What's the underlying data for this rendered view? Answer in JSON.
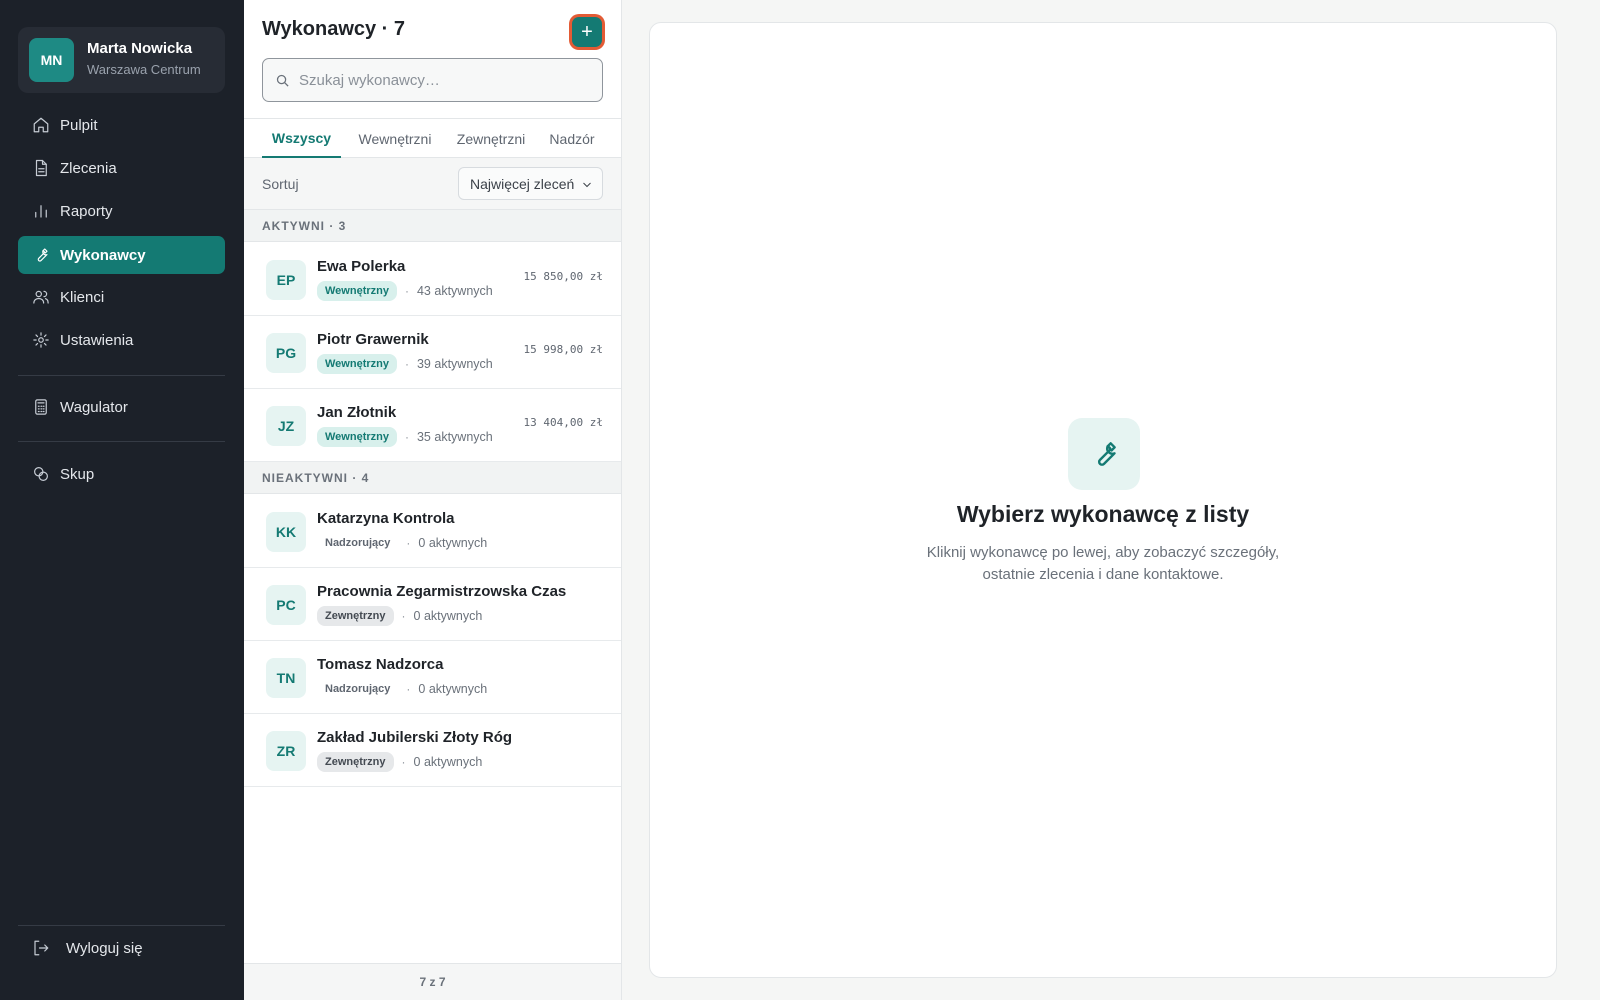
{
  "user": {
    "initials": "MN",
    "name": "Marta Nowicka",
    "location": "Warszawa Centrum"
  },
  "nav": {
    "items": [
      {
        "label": "Pulpit",
        "icon": "home-icon"
      },
      {
        "label": "Zlecenia",
        "icon": "document-icon"
      },
      {
        "label": "Raporty",
        "icon": "bar-chart-icon"
      },
      {
        "label": "Wykonawcy",
        "icon": "wrench-icon",
        "active": true
      },
      {
        "label": "Klienci",
        "icon": "users-icon"
      },
      {
        "label": "Ustawienia",
        "icon": "gear-icon"
      }
    ],
    "extra": [
      {
        "label": "Wagulator",
        "icon": "calculator-icon"
      },
      {
        "label": "Skup",
        "icon": "coins-icon"
      }
    ],
    "logout": "Wyloguj się"
  },
  "list": {
    "title": "Wykonawcy · 7",
    "add_label": "+",
    "search_placeholder": "Szukaj wykonawcy…",
    "tabs": [
      "Wszyscy",
      "Wewnętrzni",
      "Zewnętrzni",
      "Nadzór"
    ],
    "sort_label": "Sortuj",
    "sort_value": "Najwięcej zleceń",
    "groups": [
      {
        "label": "AKTYWNI · 3",
        "rows": [
          {
            "initials": "EP",
            "name": "Ewa Polerka",
            "type": "Wewnętrzny",
            "dot": "·",
            "active_count": "43 aktywnych",
            "amount": "15 850,00 zł"
          },
          {
            "initials": "PG",
            "name": "Piotr Grawernik",
            "type": "Wewnętrzny",
            "dot": "·",
            "active_count": "39 aktywnych",
            "amount": "15 998,00 zł"
          },
          {
            "initials": "JZ",
            "name": "Jan Złotnik",
            "type": "Wewnętrzny",
            "dot": "·",
            "active_count": "35 aktywnych",
            "amount": "13 404,00 zł"
          }
        ]
      },
      {
        "label": "NIEAKTYWNI · 4",
        "rows": [
          {
            "initials": "KK",
            "name": "Katarzyna Kontrola",
            "type": "Nadzorujący",
            "dot": "·",
            "active_count": "0 aktywnych"
          },
          {
            "initials": "PC",
            "name": "Pracownia Zegarmistrzowska Czas",
            "type": "Zewnętrzny",
            "dot": "·",
            "active_count": "0 aktywnych"
          },
          {
            "initials": "TN",
            "name": "Tomasz Nadzorca",
            "type": "Nadzorujący",
            "dot": "·",
            "active_count": "0 aktywnych"
          },
          {
            "initials": "ZR",
            "name": "Zakład Jubilerski Złoty Róg",
            "type": "Zewnętrzny",
            "dot": "·",
            "active_count": "0 aktywnych"
          }
        ]
      }
    ],
    "footer": "7 z 7"
  },
  "detail": {
    "icon": "wrench-icon",
    "title": "Wybierz wykonawcę z listy",
    "description": "Kliknij wykonawcę po lewej, aby zobaczyć szczegóły, ostatnie zlecenia i dane kontaktowe."
  },
  "colors": {
    "accent": "#147a73",
    "sidebar": "#1c2129",
    "highlight": "#e35b35"
  }
}
